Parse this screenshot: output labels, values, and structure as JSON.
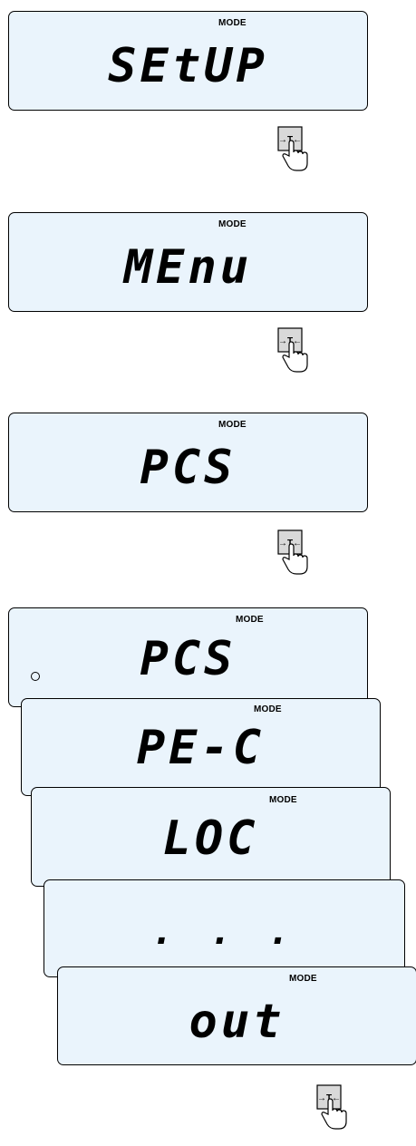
{
  "displays": [
    {
      "mode": "MODE",
      "text": "SEtUP"
    },
    {
      "mode": "MODE",
      "text": "MEnu"
    },
    {
      "mode": "MODE",
      "text": "PCS"
    },
    {
      "mode": "MODE",
      "text": "PCS"
    },
    {
      "mode": "MODE",
      "text": "PE-C"
    },
    {
      "mode": "MODE",
      "text": "LOC"
    },
    {
      "mode": "",
      "text": ". . ."
    },
    {
      "mode": "MODE",
      "text": "out"
    }
  ],
  "tare_key": {
    "label": "→T←",
    "icon": "hand-pointer-icon"
  }
}
